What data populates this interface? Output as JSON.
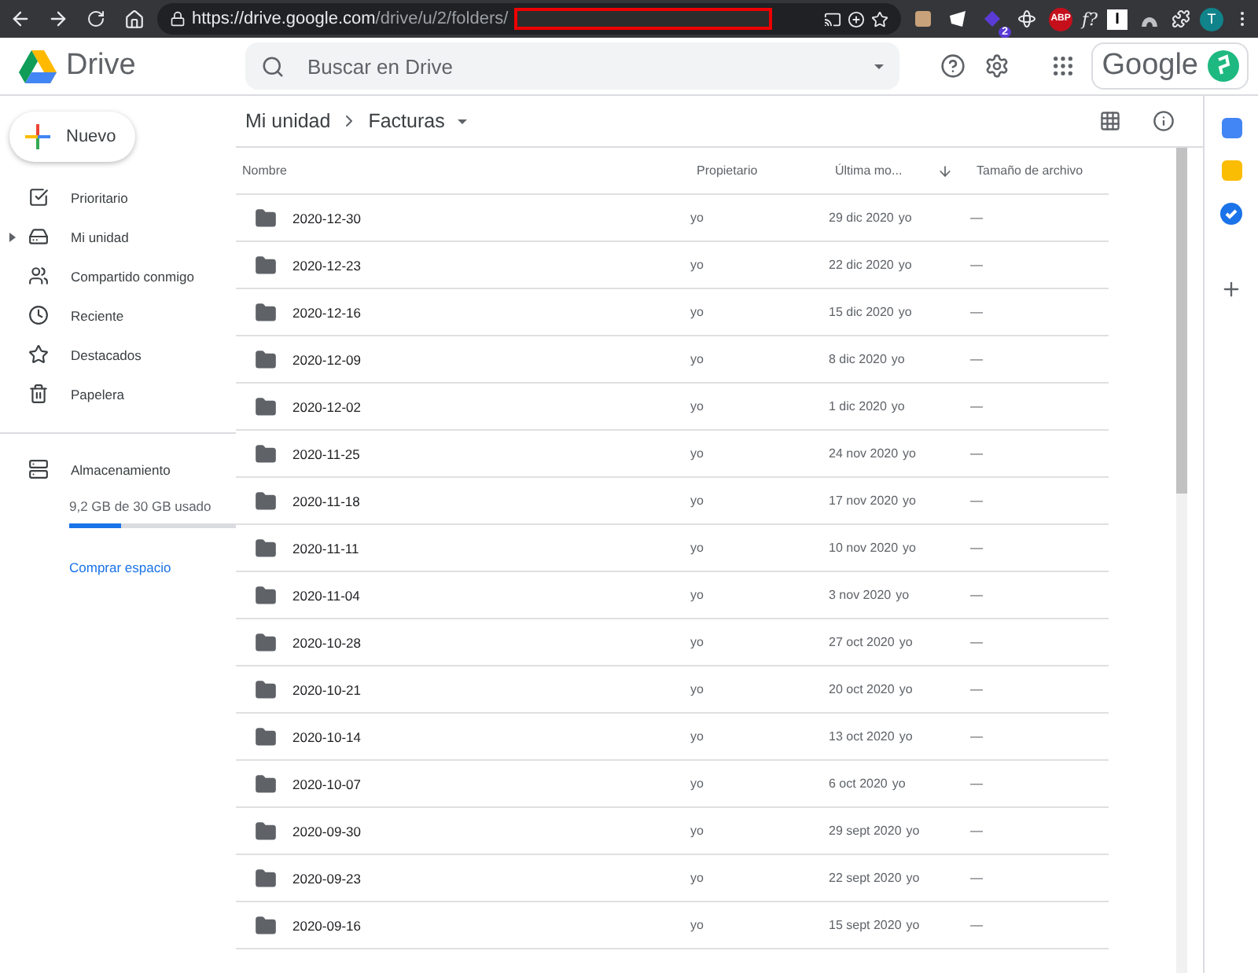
{
  "browser": {
    "url_host": "https://drive.google.com",
    "url_path": "/drive/u/2/folders/",
    "extension_badge": "2",
    "abp_label": "ABP",
    "formula_label": "f?",
    "reader_label": "I",
    "avatar_letter": "T"
  },
  "header": {
    "app_name": "Drive",
    "search_placeholder": "Buscar en Drive",
    "account_brand": "Google"
  },
  "sidebar": {
    "new_button": "Nuevo",
    "items": [
      {
        "label": "Prioritario",
        "collapsed": false
      },
      {
        "label": "Mi unidad",
        "collapsed": true
      },
      {
        "label": "Compartido conmigo",
        "collapsed": false
      },
      {
        "label": "Reciente",
        "collapsed": false
      },
      {
        "label": "Destacados",
        "collapsed": false
      },
      {
        "label": "Papelera",
        "collapsed": false
      }
    ],
    "storage": {
      "label": "Almacenamiento",
      "usage": "9,2 GB de 30 GB usado",
      "level": 0.31,
      "buy_link": "Comprar espacio"
    }
  },
  "breadcrumb": [
    "Mi unidad",
    "Facturas"
  ],
  "table": {
    "columns": [
      {
        "label": "Nombre",
        "sorted": false
      },
      {
        "label": "Propietario",
        "sorted": false
      },
      {
        "label": "Última mo...",
        "sorted": true
      },
      {
        "label": "Tamaño de archivo",
        "sorted": false
      }
    ],
    "rows": [
      {
        "name": "2020-12-30",
        "owner": "yo",
        "modified": "29 dic 2020",
        "modified_by": "yo",
        "size": "—"
      },
      {
        "name": "2020-12-23",
        "owner": "yo",
        "modified": "22 dic 2020",
        "modified_by": "yo",
        "size": "—"
      },
      {
        "name": "2020-12-16",
        "owner": "yo",
        "modified": "15 dic 2020",
        "modified_by": "yo",
        "size": "—"
      },
      {
        "name": "2020-12-09",
        "owner": "yo",
        "modified": "8 dic 2020",
        "modified_by": "yo",
        "size": "—"
      },
      {
        "name": "2020-12-02",
        "owner": "yo",
        "modified": "1 dic 2020",
        "modified_by": "yo",
        "size": "—"
      },
      {
        "name": "2020-11-25",
        "owner": "yo",
        "modified": "24 nov 2020",
        "modified_by": "yo",
        "size": "—"
      },
      {
        "name": "2020-11-18",
        "owner": "yo",
        "modified": "17 nov 2020",
        "modified_by": "yo",
        "size": "—"
      },
      {
        "name": "2020-11-11",
        "owner": "yo",
        "modified": "10 nov 2020",
        "modified_by": "yo",
        "size": "—"
      },
      {
        "name": "2020-11-04",
        "owner": "yo",
        "modified": "3 nov 2020",
        "modified_by": "yo",
        "size": "—"
      },
      {
        "name": "2020-10-28",
        "owner": "yo",
        "modified": "27 oct 2020",
        "modified_by": "yo",
        "size": "—"
      },
      {
        "name": "2020-10-21",
        "owner": "yo",
        "modified": "20 oct 2020",
        "modified_by": "yo",
        "size": "—"
      },
      {
        "name": "2020-10-14",
        "owner": "yo",
        "modified": "13 oct 2020",
        "modified_by": "yo",
        "size": "—"
      },
      {
        "name": "2020-10-07",
        "owner": "yo",
        "modified": "6 oct 2020",
        "modified_by": "yo",
        "size": "—"
      },
      {
        "name": "2020-09-30",
        "owner": "yo",
        "modified": "29 sept 2020",
        "modified_by": "yo",
        "size": "—"
      },
      {
        "name": "2020-09-23",
        "owner": "yo",
        "modified": "22 sept 2020",
        "modified_by": "yo",
        "size": "—"
      },
      {
        "name": "2020-09-16",
        "owner": "yo",
        "modified": "15 sept 2020",
        "modified_by": "yo",
        "size": "—"
      }
    ]
  }
}
